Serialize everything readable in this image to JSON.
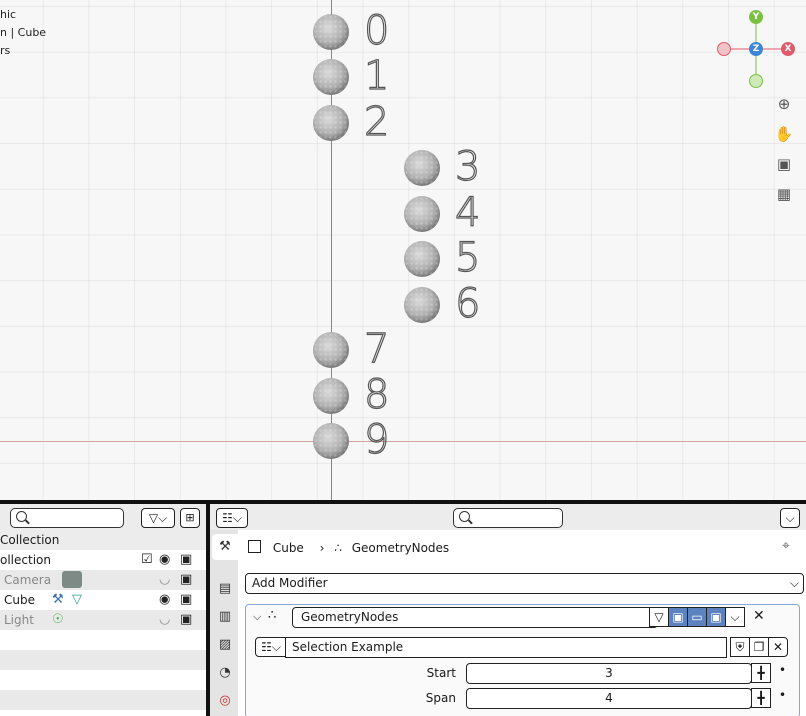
{
  "viewport": {
    "info_lines": [
      "hic",
      "n | Cube",
      "rs"
    ],
    "labels": [
      "0",
      "1",
      "2",
      "3",
      "4",
      "5",
      "6",
      "7",
      "8",
      "9"
    ],
    "gizmo": {
      "y": "Y",
      "z": "Z",
      "x": "X"
    },
    "nav_icons": [
      "zoom-icon",
      "hand-icon",
      "camera-icon",
      "grid-icon"
    ]
  },
  "outliner": {
    "header_collection": "Collection",
    "rows": [
      {
        "label": "ollection",
        "dim": false
      },
      {
        "label": "Camera",
        "dim": true
      },
      {
        "label": "Cube",
        "dim": false
      },
      {
        "label": "Light",
        "dim": true
      }
    ]
  },
  "properties": {
    "breadcrumb_object": "Cube",
    "breadcrumb_modifier": "GeometryNodes",
    "add_modifier": "Add Modifier",
    "modifier_name": "GeometryNodes",
    "node_group": "Selection Example",
    "inputs": [
      {
        "label": "Start",
        "value": "3"
      },
      {
        "label": "Span",
        "value": "4"
      }
    ]
  },
  "colors": {
    "axis_x": "#e05a6b",
    "axis_y": "#7bc043",
    "axis_z": "#3b86d6",
    "active_blue": "#5d82c0"
  }
}
